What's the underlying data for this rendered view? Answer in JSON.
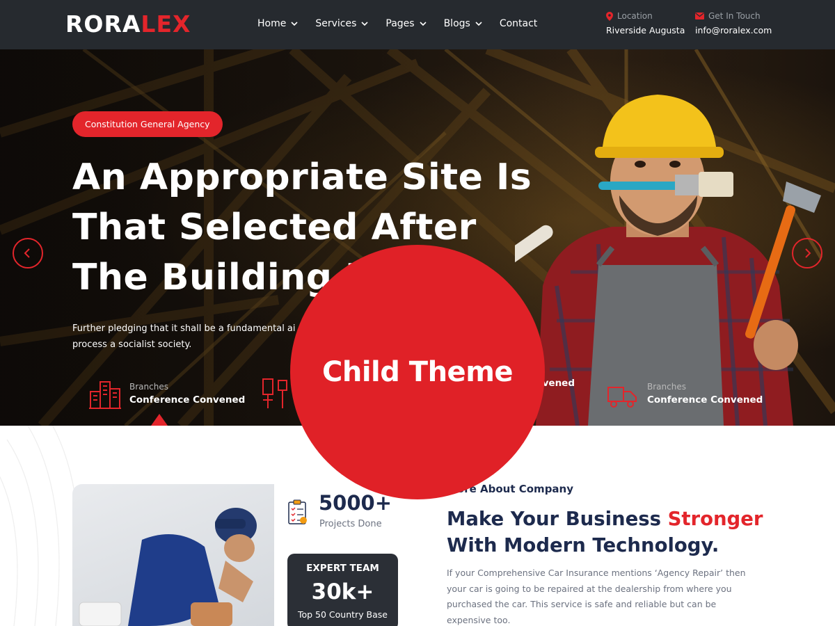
{
  "brand": {
    "logo_part1": "RORA",
    "logo_part2": "LEX"
  },
  "nav": [
    {
      "label": "Home",
      "dropdown": true
    },
    {
      "label": "Services",
      "dropdown": true
    },
    {
      "label": "Pages",
      "dropdown": true
    },
    {
      "label": "Blogs",
      "dropdown": true
    },
    {
      "label": "Contact",
      "dropdown": false
    }
  ],
  "contact": {
    "location_label": "Location",
    "location_value": "Riverside Augusta",
    "touch_label": "Get In Touch",
    "touch_value": "info@roralex.com"
  },
  "hero": {
    "badge": "Constitution General Agency",
    "title_line1": "An Appropriate Site Is",
    "title_line2": "That Selected After",
    "title_line3": "The Building I",
    "desc_line1": "Further pledging that it shall be a fundamental ai",
    "desc_line2": "process a socialist society.",
    "features": [
      {
        "title": "Branches",
        "value": "Conference Convened",
        "icon": "buildings-icon"
      },
      {
        "title": "",
        "value": "",
        "icon": "tools-icon"
      },
      {
        "title": "",
        "value": "nvened",
        "icon": ""
      },
      {
        "title": "Branches",
        "value": "Conference Convened",
        "icon": "truck-icon"
      }
    ]
  },
  "stats": {
    "projects_number": "5000+",
    "projects_caption": "Projects Done"
  },
  "team": {
    "title": "EXPERT TEAM",
    "number": "30k+",
    "caption": "Top 50 Country Base"
  },
  "about": {
    "tag": "More About Company",
    "title_part1": "Make Your Business ",
    "title_highlight": "Stronger",
    "title_line2": "With Modern Technology.",
    "body_line1": "If your Comprehensive Car Insurance mentions ‘Agency Repair’ then",
    "body_line2": "your car is going to be repaired at the dealership from where you",
    "body_line3": "purchased the car. This service is safe and reliable but can be",
    "body_line4": "expensive too."
  },
  "overlay": {
    "label": "Child Theme"
  },
  "colors": {
    "accent": "#e3252b",
    "header_bg": "#262a2f",
    "navy": "#1d2a4d"
  }
}
